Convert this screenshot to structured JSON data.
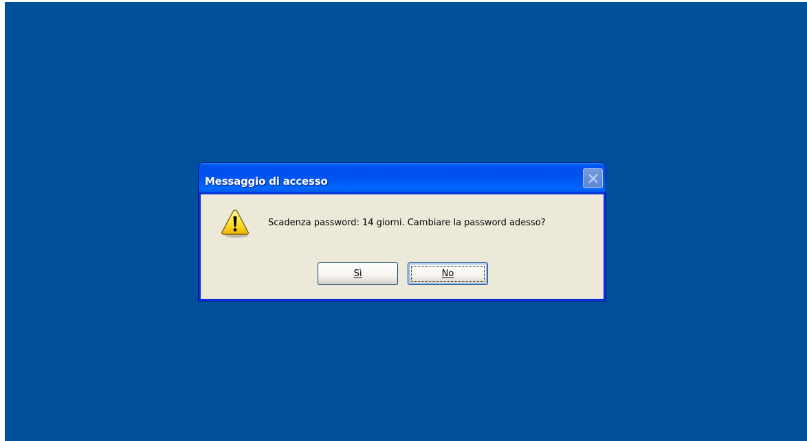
{
  "dialog": {
    "title": "Messaggio di accesso",
    "message": "Scadenza password: 14 giorni. Cambiare la password adesso?",
    "icon": "warning-icon"
  },
  "buttons": {
    "yes_label": "Sì",
    "no_label": "No"
  },
  "colors": {
    "desktop": "#00509a",
    "titlebar": "#0054e3",
    "client": "#ece9d8"
  }
}
